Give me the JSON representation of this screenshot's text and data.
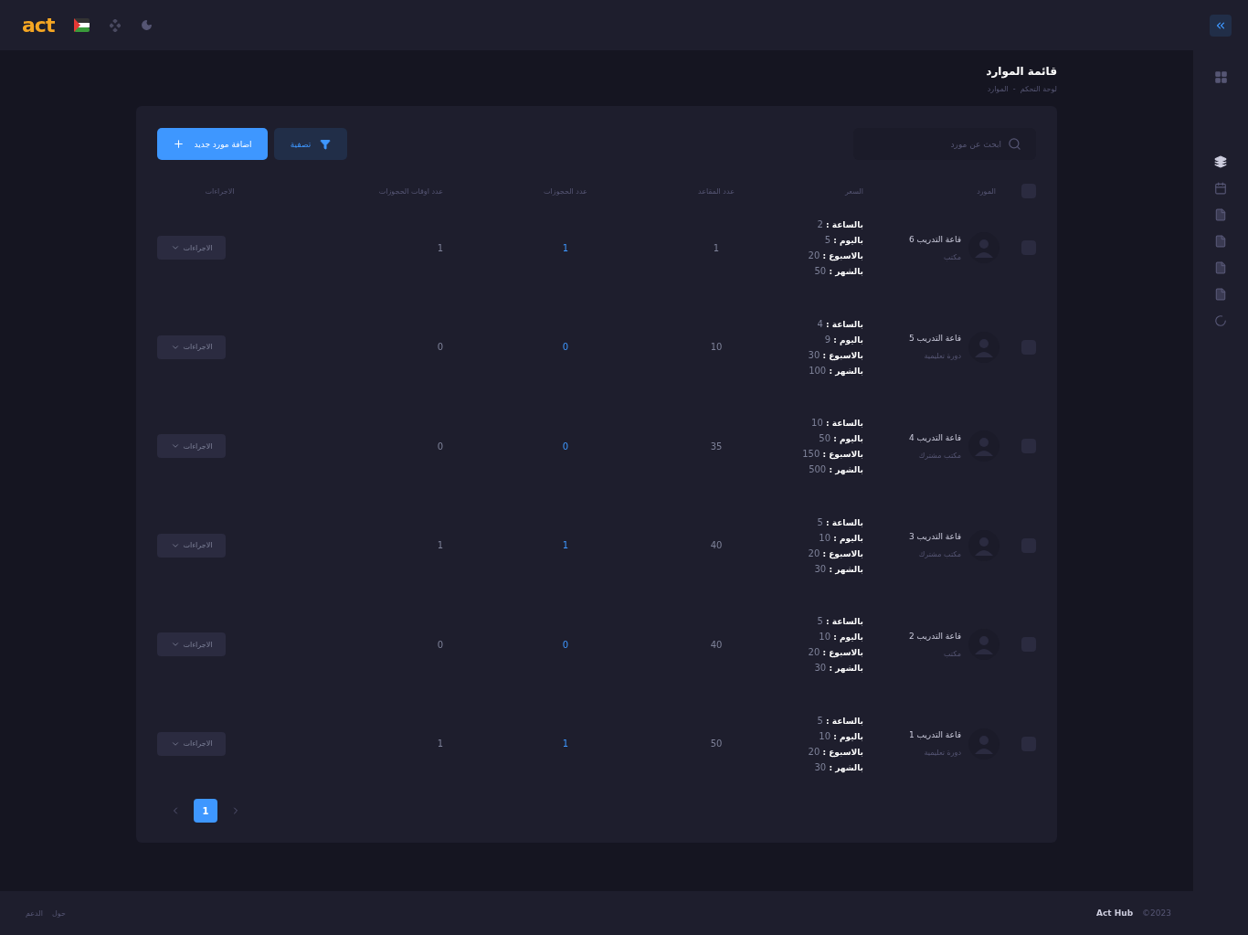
{
  "topbar": {
    "logo": "act"
  },
  "page": {
    "title": "قائمة الموارد",
    "breadcrumb": [
      "لوحة التحكم",
      "-",
      "الموارد"
    ]
  },
  "toolbar": {
    "search": {
      "placeholder": "ابحث عن مورد"
    },
    "filter_button": "تصفية",
    "add_button": "اضافة مورد جديد"
  },
  "table": {
    "header_checked": false,
    "columns": [
      "المورد",
      "السعر",
      "عدد المقاعد",
      "عدد الحجوزات",
      "عدد اوقات الحجوزات",
      "الاجراءات"
    ],
    "rows": [
      {
        "checked": false,
        "name": "قاعة التدريب 6",
        "type": "مكتب",
        "prices": [
          "**بالساعة :** 2",
          "**باليوم :** 5",
          "**بالاسبوع :** 20",
          "**بالشهر :** 50"
        ],
        "seats": "1",
        "bookings": "1",
        "booking_times": "1",
        "action": "الاجراءات"
      },
      {
        "checked": false,
        "name": "قاعة التدريب 5",
        "type": "دورة تعليمية",
        "prices": [
          "**بالساعة :** 4",
          "**باليوم :** 9",
          "**بالاسبوع :** 30",
          "**بالشهر :** 100"
        ],
        "seats": "10",
        "bookings": "0",
        "booking_times": "0",
        "action": "الاجراءات"
      },
      {
        "checked": false,
        "name": "قاعة التدريب 4",
        "type": "مكتب مشترك",
        "prices": [
          "**بالساعة :** 10",
          "**باليوم :** 50",
          "**بالاسبوع :** 150",
          "**بالشهر :** 500"
        ],
        "seats": "35",
        "bookings": "0",
        "booking_times": "0",
        "action": "الاجراءات"
      },
      {
        "checked": false,
        "name": "قاعة التدريب 3",
        "type": "مكتب مشترك",
        "prices": [
          "**بالساعة :** 5",
          "**باليوم :** 10",
          "**بالاسبوع :** 20",
          "**بالشهر :** 30"
        ],
        "seats": "40",
        "bookings": "1",
        "booking_times": "1",
        "action": "الاجراءات"
      },
      {
        "checked": false,
        "name": "قاعة التدريب 2",
        "type": "مكتب",
        "prices": [
          "**بالساعة :** 5",
          "**باليوم :** 10",
          "**بالاسبوع :** 20",
          "**بالشهر :** 30"
        ],
        "seats": "40",
        "bookings": "0",
        "booking_times": "0",
        "action": "الاجراءات"
      },
      {
        "checked": false,
        "name": "قاعة التدريب 1",
        "type": "دورة تعليمية",
        "prices": [
          "**بالساعة :** 5",
          "**باليوم :** 10",
          "**بالاسبوع :** 20",
          "**بالشهر :** 30"
        ],
        "seats": "50",
        "bookings": "1",
        "booking_times": "1",
        "action": "الاجراءات"
      }
    ]
  },
  "pagination": {
    "pages": [
      {
        "label": "1",
        "selected": true
      }
    ]
  },
  "footer": {
    "links": [
      "حول",
      "الدعم"
    ],
    "brand": "Act Hub",
    "copyright": "©2023"
  }
}
